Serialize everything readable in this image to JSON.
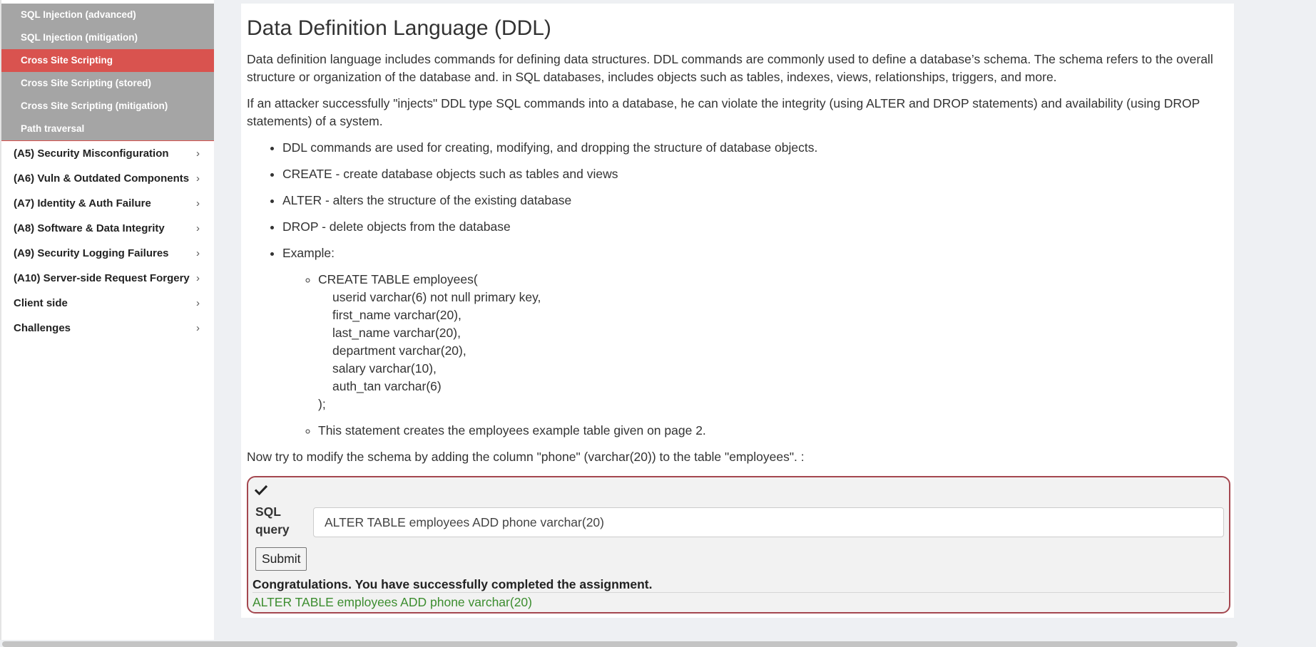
{
  "sidebar": {
    "submenu": [
      {
        "label": "SQL Injection (advanced)",
        "active": false
      },
      {
        "label": "SQL Injection (mitigation)",
        "active": false
      },
      {
        "label": "Cross Site Scripting",
        "active": true
      },
      {
        "label": "Cross Site Scripting (stored)",
        "active": false
      },
      {
        "label": "Cross Site Scripting (mitigation)",
        "active": false
      },
      {
        "label": "Path traversal",
        "active": false
      }
    ],
    "sections": [
      {
        "label": "(A5) Security Misconfiguration"
      },
      {
        "label": "(A6) Vuln & Outdated Components"
      },
      {
        "label": "(A7) Identity & Auth Failure"
      },
      {
        "label": "(A8) Software & Data Integrity"
      },
      {
        "label": "(A9) Security Logging Failures"
      },
      {
        "label": "(A10) Server-side Request Forgery"
      },
      {
        "label": "Client side"
      },
      {
        "label": "Challenges"
      }
    ],
    "chevron_glyph": "›",
    "active_color": "#d9534f"
  },
  "main": {
    "title": "Data Definition Language (DDL)",
    "paragraph1": "Data definition language includes commands for defining data structures. DDL commands are commonly used to define a database’s schema. The schema refers to the overall structure or organization of the database and. in SQL databases, includes objects such as tables, indexes, views, relationships, triggers, and more.",
    "paragraph2": "If an attacker successfully \"injects\" DDL type SQL commands into a database, he can violate the integrity (using ALTER and DROP statements) and availability (using DROP statements) of a system.",
    "bullets": [
      "DDL commands are used for creating, modifying, and dropping the structure of database objects.",
      "CREATE - create database objects such as tables and views",
      "ALTER - alters the structure of the existing database",
      "DROP - delete objects from the database",
      "Example:"
    ],
    "example": {
      "code_first": "CREATE TABLE employees(",
      "code_lines": [
        "userid varchar(6) not null primary key,",
        "first_name varchar(20),",
        "last_name varchar(20),",
        "department varchar(20),",
        "salary varchar(10),",
        "auth_tan varchar(6)"
      ],
      "code_last": ");",
      "note": "This statement creates the employees example table given on page 2."
    },
    "instruction": "Now try to modify the schema by adding the column \"phone\" (varchar(20)) to the table \"employees\". :"
  },
  "assignment": {
    "status_icon": "check-icon",
    "label": "SQL query",
    "input_value": "ALTER TABLE employees ADD phone varchar(20)",
    "submit_label": "Submit",
    "feedback": "Congratulations. You have successfully completed the assignment.",
    "output": "ALTER TABLE employees ADD phone varchar(20)",
    "border_color": "#a4474f",
    "output_color": "#3c8d2f"
  }
}
